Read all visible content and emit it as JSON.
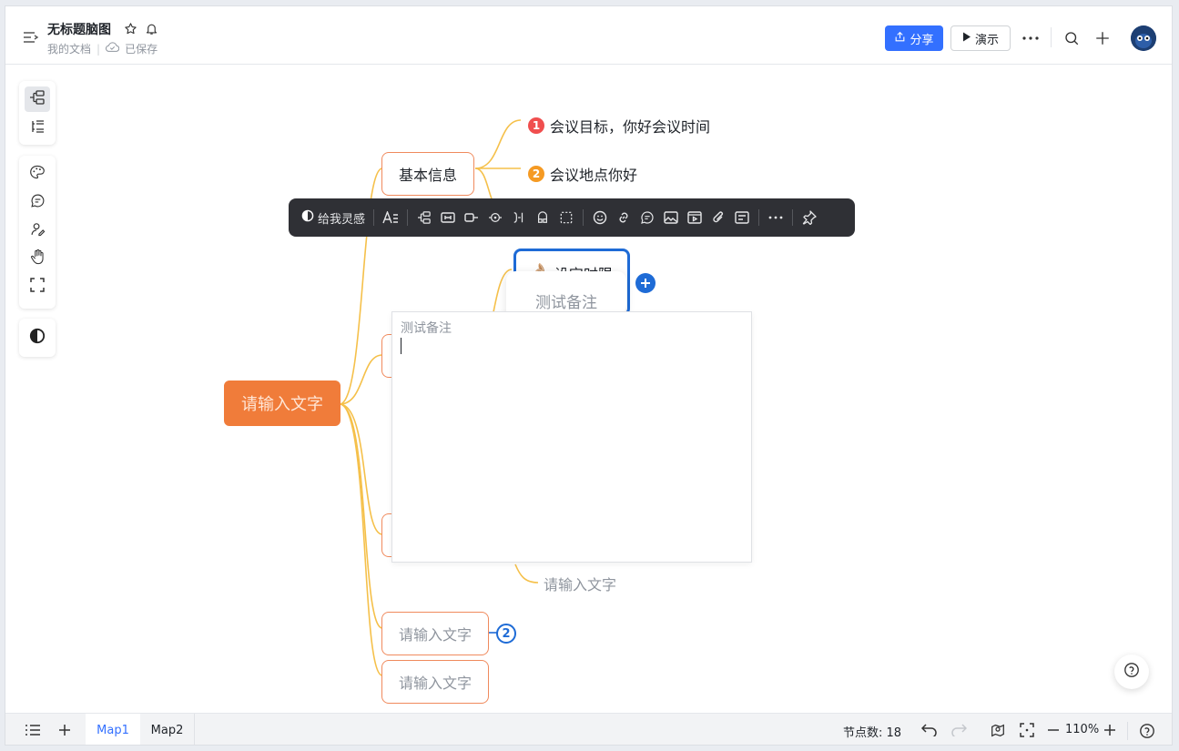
{
  "header": {
    "doc_title": "无标题脑图",
    "breadcrumb": "我的文档",
    "save_status": "已保存",
    "share_label": "分享",
    "present_label": "演示"
  },
  "toolbar": {
    "inspire_label": "给我灵感"
  },
  "mindmap": {
    "root": "请输入文字",
    "branch_basic": "基本信息",
    "leaf_goal": "会议目标，你好会议时间",
    "leaf_goal_num": "1",
    "leaf_place": "会议地点你好",
    "leaf_place_num": "2",
    "node_time_emoji": "👌🏼",
    "node_time": "设定时限",
    "leaf_child": "请输入文字",
    "node_a": "请输入文字",
    "node_a_count": "2",
    "node_b": "请输入文字"
  },
  "note": {
    "tooltip": "测试备注",
    "placeholder": "测试备注"
  },
  "bottom": {
    "tab1": "Map1",
    "tab2": "Map2",
    "node_count": "节点数: 18",
    "zoom": "110%"
  },
  "colors": {
    "accent": "#3370ff",
    "root": "#f07c3a",
    "branch_line": "#f5c04a",
    "node_border": "#f08a5d",
    "badge_red": "#f04e4e",
    "badge_orange": "#f59a23",
    "toolbar_bg": "#2f3035"
  }
}
